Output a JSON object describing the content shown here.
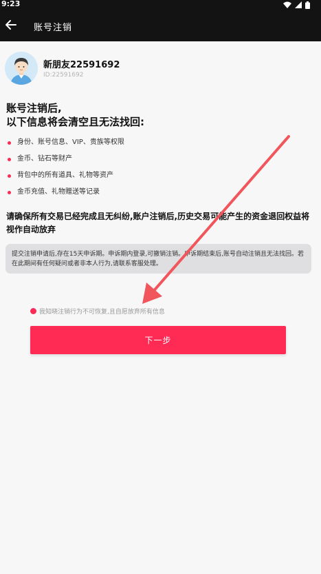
{
  "status_bar": {
    "time": "9:23",
    "icons": [
      "wifi-icon",
      "signal-icon",
      "battery-icon"
    ]
  },
  "app_bar": {
    "back_icon": "arrow-left-icon",
    "title": "账号注销"
  },
  "profile": {
    "nickname": "新朋友22591692",
    "uid": "ID:22591692"
  },
  "heading": {
    "line1": "账号注销后,",
    "line2": "以下信息将会清空且无法找回:"
  },
  "cleared_items": [
    "身份、账号信息、VIP、贵族等权限",
    "金币、钻石等财产",
    "背包中的所有道具、礼物等资产",
    "金币充值、礼物赠送等记录"
  ],
  "warning_text": "请确保所有交易已经完成且无纠纷,账户注销后,历史交易可能产生的资金退回权益将视作自动放弃",
  "notice_text": "提交注销申请后,存在15天申诉期。申诉期内登录,可撤销注销。申诉期结束后,账号自动注销且无法找回。若在此期间有任何疑问或者非本人行为,请联系客服处理。",
  "agreement": {
    "checked": true,
    "label": "我知晓注销行为不可恢复,且自愿放弃所有信息"
  },
  "next_button": {
    "label": "下一步"
  },
  "colors": {
    "accent": "#ff2b55",
    "app_bar": "#131313",
    "background": "#f7f7f8",
    "notice_bg": "#dfdfe1",
    "annotation_arrow": "#f0565c"
  }
}
